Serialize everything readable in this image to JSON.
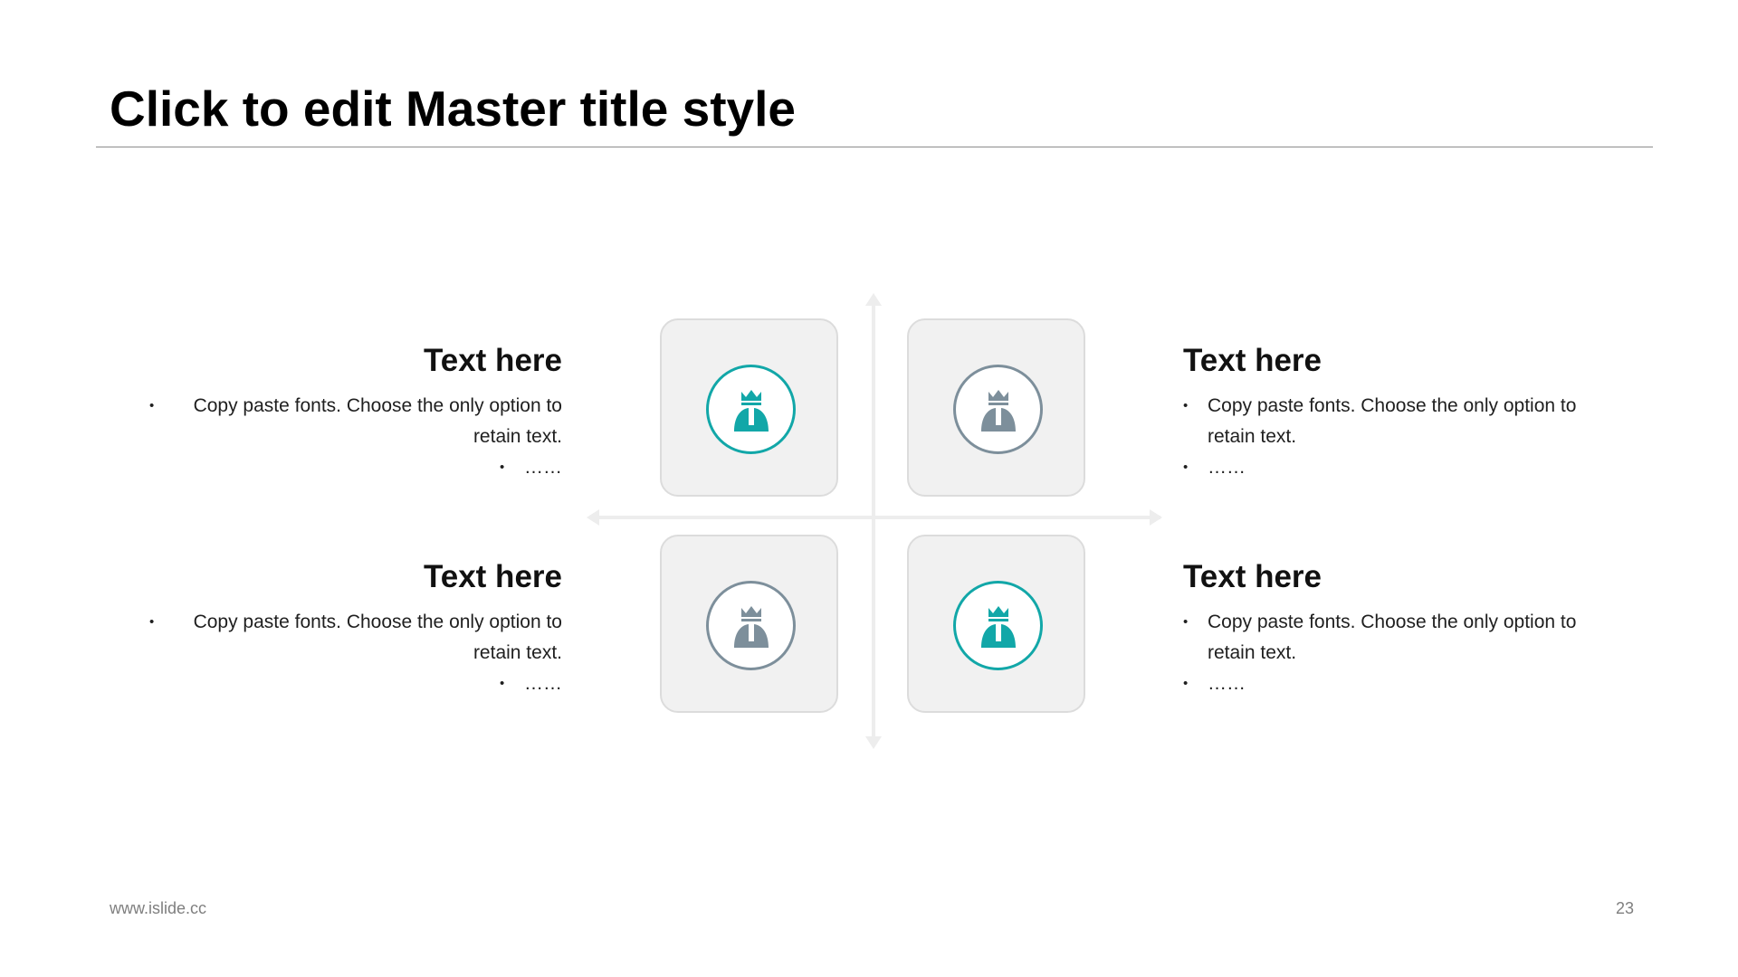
{
  "slide": {
    "title": "Click to edit Master title style",
    "footer_url": "www.islide.cc",
    "page_number": "23"
  },
  "colors": {
    "accent_teal": "#12a7a8",
    "accent_gray": "#7d8f9b"
  },
  "quadrants": {
    "top_left": {
      "heading": "Text here",
      "bullet1": "Copy paste fonts. Choose the only option to retain text.",
      "bullet2": "……",
      "icon": "king-person-icon",
      "icon_color": "teal"
    },
    "top_right": {
      "heading": "Text here",
      "bullet1": "Copy paste fonts. Choose the only option to retain text.",
      "bullet2": "……",
      "icon": "king-person-icon",
      "icon_color": "gray"
    },
    "bottom_left": {
      "heading": "Text here",
      "bullet1": "Copy paste fonts. Choose the only option to retain text.",
      "bullet2": "……",
      "icon": "king-person-icon",
      "icon_color": "gray"
    },
    "bottom_right": {
      "heading": "Text here",
      "bullet1": "Copy paste fonts. Choose the only option to retain text.",
      "bullet2": "……",
      "icon": "king-person-icon",
      "icon_color": "teal"
    }
  }
}
